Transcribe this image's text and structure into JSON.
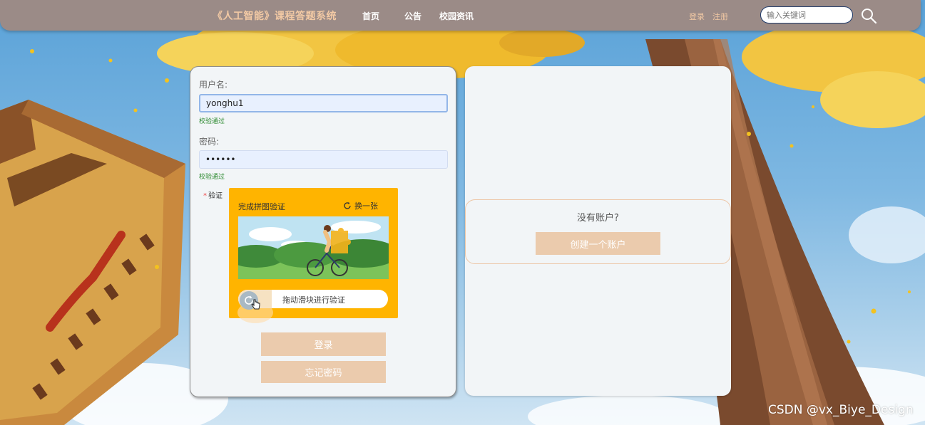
{
  "navbar": {
    "title": "《人工智能》课程答题系统",
    "links": [
      "首页",
      "公告",
      "校园资讯"
    ],
    "login_link": "登录",
    "register_link": "注册",
    "search_placeholder": "输入关键词"
  },
  "login_form": {
    "username_label": "用户名:",
    "username_value": "yonghu1",
    "username_status": "校验通过",
    "password_label": "密码:",
    "password_value": "••••••",
    "password_status": "校验通过",
    "captcha_label": "验证",
    "captcha_title": "完成拼图验证",
    "captcha_refresh": "换一张",
    "slider_text": "拖动滑块进行验证",
    "login_button": "登录",
    "forgot_button": "忘记密码"
  },
  "register": {
    "prompt": "没有账户?",
    "create_button": "创建一个账户"
  },
  "watermark": "CSDN @vx_Biye_Design",
  "colors": {
    "navbar": "#9b8b87",
    "accent_text": "#f2c9a4",
    "button": "#ebcbad",
    "captcha": "#ffb400",
    "valid": "#2e8b32"
  }
}
